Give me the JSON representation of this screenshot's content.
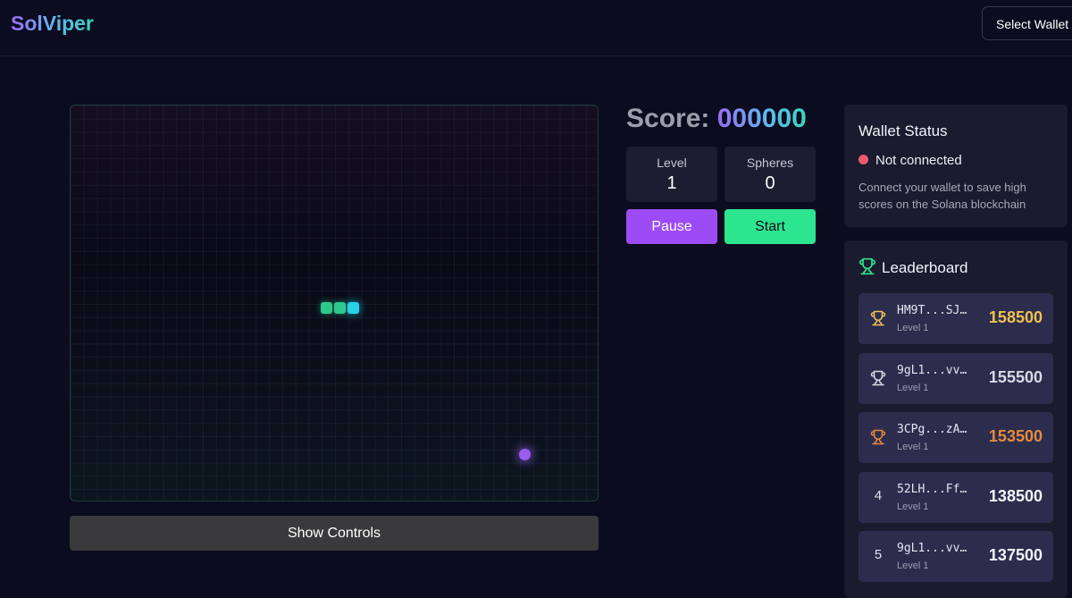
{
  "header": {
    "logo": "SolViper",
    "wallet_button": "Select Wallet"
  },
  "game": {
    "snake": [
      {
        "part": "body"
      },
      {
        "part": "body"
      },
      {
        "part": "head"
      }
    ],
    "controls_label": "Show Controls"
  },
  "score": {
    "label": "Score:",
    "value": "000000"
  },
  "stats": {
    "level": {
      "label": "Level",
      "value": "1"
    },
    "spheres": {
      "label": "Spheres",
      "value": "0"
    }
  },
  "buttons": {
    "pause": "Pause",
    "start": "Start"
  },
  "wallet_status": {
    "title": "Wallet Status",
    "status": "Not connected",
    "note": "Connect your wallet to save high scores on the Solana blockchain"
  },
  "leaderboard": {
    "title": "Leaderboard",
    "entries": [
      {
        "rank": "1",
        "icon": "gold-trophy-icon",
        "color": "#f2c14e",
        "address": "HM9T...SJ…",
        "level": "Level 1",
        "score": "158500"
      },
      {
        "rank": "2",
        "icon": "silver-trophy-icon",
        "color": "#d7d9e4",
        "address": "9gL1...vv…",
        "level": "Level 1",
        "score": "155500"
      },
      {
        "rank": "3",
        "icon": "bronze-trophy-icon",
        "color": "#e8893c",
        "address": "3CPg...zA…",
        "level": "Level 1",
        "score": "153500"
      },
      {
        "rank": "4",
        "icon": "",
        "color": "#f4f5fb",
        "address": "52LH...Ff…",
        "level": "Level 1",
        "score": "138500"
      },
      {
        "rank": "5",
        "icon": "",
        "color": "#f4f5fb",
        "address": "9gL1...vv…",
        "level": "Level 1",
        "score": "137500"
      }
    ]
  },
  "colors": {
    "background": "#0b0c1f",
    "accent_purple": "#9d4cf5",
    "accent_green": "#2ee58f",
    "snake_head": "#27d3e8",
    "snake_body": "#2ec98a",
    "sphere": "#9b5cf0"
  }
}
